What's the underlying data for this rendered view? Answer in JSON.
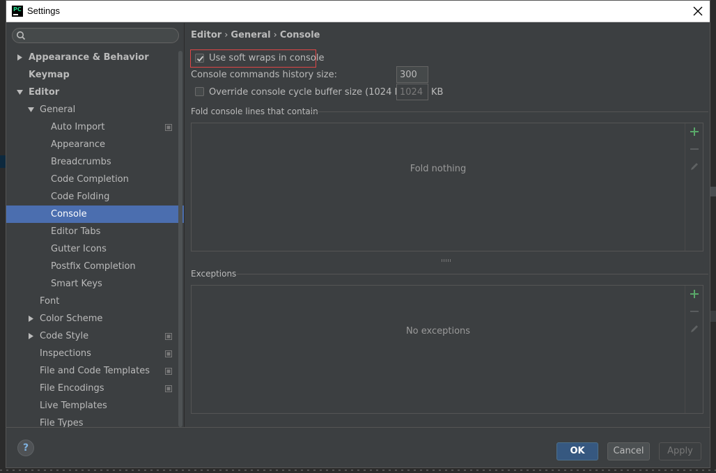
{
  "window": {
    "title": "Settings",
    "app_icon": "pycharm-logo",
    "app_icon_text": "PC"
  },
  "search": {
    "placeholder": "",
    "value": ""
  },
  "sidebar": {
    "items": [
      {
        "label": "Appearance & Behavior",
        "level": 0,
        "arrow": "right",
        "bold": true
      },
      {
        "label": "Keymap",
        "level": 0,
        "arrow": "",
        "bold": true
      },
      {
        "label": "Editor",
        "level": 0,
        "arrow": "down",
        "bold": true
      },
      {
        "label": "General",
        "level": 1,
        "arrow": "down"
      },
      {
        "label": "Auto Import",
        "level": 2,
        "project_icon": true
      },
      {
        "label": "Appearance",
        "level": 2
      },
      {
        "label": "Breadcrumbs",
        "level": 2
      },
      {
        "label": "Code Completion",
        "level": 2
      },
      {
        "label": "Code Folding",
        "level": 2
      },
      {
        "label": "Console",
        "level": 2,
        "selected": true
      },
      {
        "label": "Editor Tabs",
        "level": 2
      },
      {
        "label": "Gutter Icons",
        "level": 2
      },
      {
        "label": "Postfix Completion",
        "level": 2
      },
      {
        "label": "Smart Keys",
        "level": 2
      },
      {
        "label": "Font",
        "level": 1
      },
      {
        "label": "Color Scheme",
        "level": 1,
        "arrow": "right"
      },
      {
        "label": "Code Style",
        "level": 1,
        "arrow": "right",
        "project_icon": true
      },
      {
        "label": "Inspections",
        "level": 1,
        "project_icon": true
      },
      {
        "label": "File and Code Templates",
        "level": 1,
        "project_icon": true
      },
      {
        "label": "File Encodings",
        "level": 1,
        "project_icon": true
      },
      {
        "label": "Live Templates",
        "level": 1
      },
      {
        "label": "File Types",
        "level": 1
      }
    ]
  },
  "breadcrumb": {
    "part1": "Editor",
    "part2": "General",
    "part3": "Console",
    "separator": "›"
  },
  "settings": {
    "soft_wraps_label": "Use soft wraps in console",
    "soft_wraps_checked": true,
    "history_label": "Console commands history size:",
    "history_value": "300",
    "override_label": "Override console cycle buffer size (1024 KB)",
    "override_checked": false,
    "buffer_value": "1024",
    "buffer_unit": "KB"
  },
  "fold_section": {
    "title": "Fold console lines that contain",
    "empty_text": "Fold nothing"
  },
  "exceptions_section": {
    "title": "Exceptions",
    "empty_text": "No exceptions"
  },
  "footer": {
    "help": "?",
    "ok": "OK",
    "cancel": "Cancel",
    "apply": "Apply"
  },
  "colors": {
    "selection": "#4b6eaf",
    "highlight_border": "#e04646",
    "add_green": "#59a869",
    "ok_button": "#365880"
  }
}
